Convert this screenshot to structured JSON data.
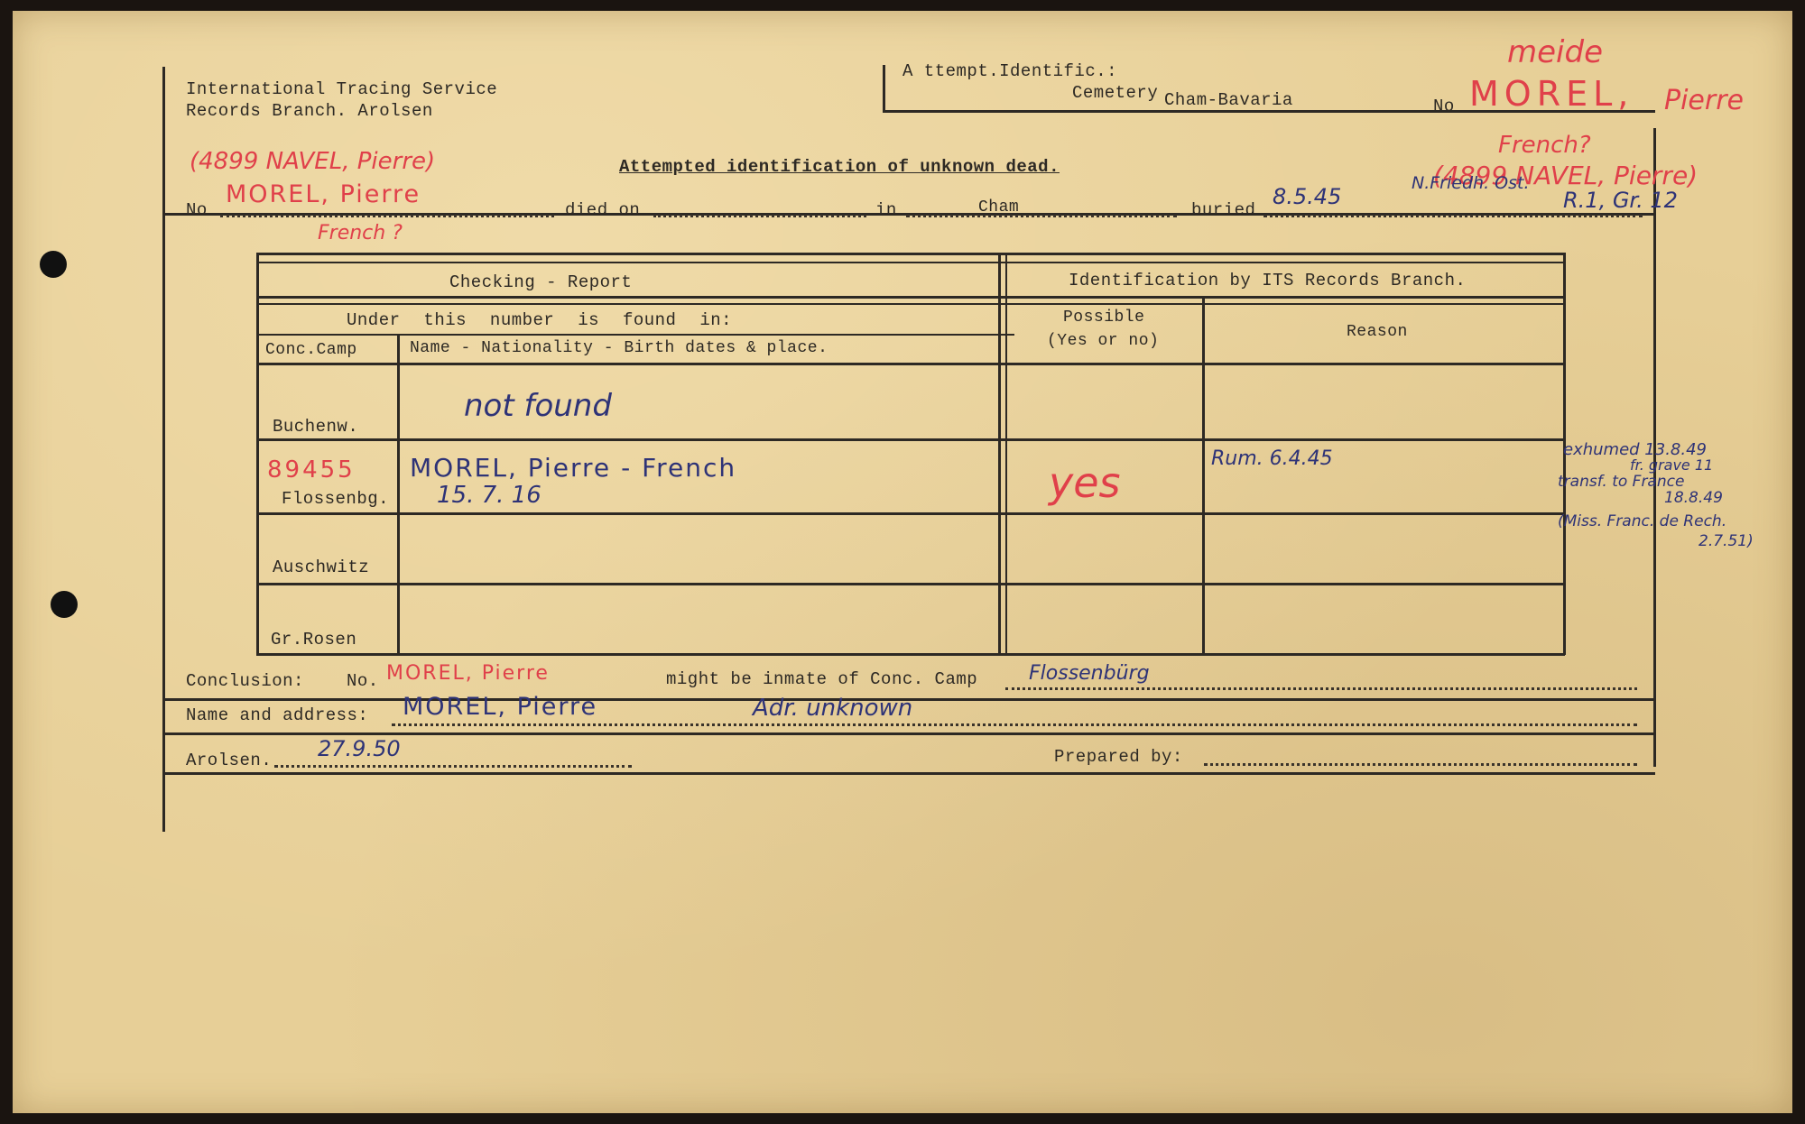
{
  "header": {
    "org_line1": "International Tracing Service",
    "org_line2": "Records Branch. Arolsen",
    "attempt_label": "A ttempt.Identific.:",
    "cemetery_label": "Cemetery",
    "cemetery_value": "Cham-Bavaria",
    "no_label": "No",
    "no_value": "MOREL,",
    "no_value2": "Pierre",
    "handwritten_top": "meide",
    "handwritten_french": "French?",
    "handwritten_navel": "(4899 NAVEL, Pierre)"
  },
  "title": "Attempted identification of unknown dead.",
  "record_line": {
    "left_navel": "(4899 NAVEL, Pierre)",
    "no_label": "No",
    "no_value": "MOREL, Pierre",
    "french_note": "French ?",
    "died_label": "died on",
    "in_label": "in",
    "in_value": "Cham",
    "buried_label": "buried",
    "buried_date": "8.5.45",
    "buried_place": "N.Friedh. Ost.",
    "buried_grave": "R.1, Gr. 12"
  },
  "table": {
    "checking_header": "Checking - Report",
    "identification_header": "Identification by ITS Records Branch.",
    "under_number": "Under this number is found in:",
    "col_camp": "Conc.Camp",
    "col_details": "Name - Nationality - Birth dates & place.",
    "col_possible_line1": "Possible",
    "col_possible_line2": "(Yes or no)",
    "col_reason": "Reason",
    "rows": [
      {
        "camp": "Buchenw.",
        "number": "",
        "details1": "not found",
        "details2": "",
        "possible": "",
        "reason": ""
      },
      {
        "camp": "Flossenbg.",
        "number": "89455",
        "details1": "MOREL,     Pierre    - French",
        "details2": "15. 7. 16",
        "possible": "yes",
        "reason": "Rum. 6.4.45"
      },
      {
        "camp": "Auschwitz",
        "number": "",
        "details1": "",
        "details2": "",
        "possible": "",
        "reason": ""
      },
      {
        "camp": "Gr.Rosen",
        "number": "",
        "details1": "",
        "details2": "",
        "possible": "",
        "reason": ""
      }
    ]
  },
  "margin_note": {
    "line1": "exhumed 13.8.49",
    "line2": "fr. grave 11",
    "line3": "transf. to France",
    "line4": "18.8.49",
    "line5": "(Miss. Franc. de Rech.",
    "line6": "2.7.51)"
  },
  "conclusion": {
    "label": "Conclusion:",
    "no_label": "No.",
    "no_value": "MOREL, Pierre",
    "middle_text": "might be inmate of Conc. Camp",
    "camp_value": "Flossenbürg"
  },
  "name_address": {
    "label": "Name and address:",
    "name_value": "MOREL, Pierre",
    "addr_value": "Adr. unknown"
  },
  "footer": {
    "place_label": "Arolsen.",
    "date_value": "27.9.50",
    "prepared_label": "Prepared by:"
  }
}
